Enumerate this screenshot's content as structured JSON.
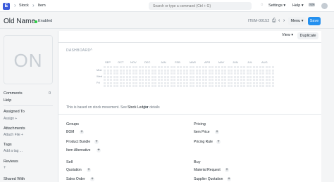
{
  "navbar": {
    "logo_letter": "E",
    "breadcrumbs": [
      "Stock",
      "Item"
    ],
    "search_placeholder": "Search or type a command (Ctrl + G)",
    "settings_label": "Settings",
    "help_label": "Help",
    "avatar_initial": "•"
  },
  "page": {
    "title": "Old Name",
    "status": "Enabled",
    "item_id": "ITEM-00152",
    "menu_label": "Menu",
    "save_label": "Save",
    "view_label": "View",
    "duplicate_label": "Duplicate"
  },
  "sidebar": {
    "image_placeholder": "ON",
    "comments_label": "Comments",
    "comments_count": "0",
    "help_label": "Help",
    "assigned_label": "Assigned To",
    "assign_label": "Assign",
    "attachments_label": "Attachments",
    "attach_label": "Attach File",
    "tags_label": "Tags",
    "add_tag_label": "Add a tag ...",
    "reviews_label": "Reviews",
    "shared_label": "Shared With"
  },
  "dashboard": {
    "title": "DASHBOARD",
    "months": [
      "SEP",
      "OCT",
      "NOV",
      "DEC",
      "JAN",
      "FEB",
      "MAR",
      "APR",
      "MAY",
      "JUN",
      "JUL",
      "AUG"
    ],
    "days": [
      "Mon",
      "Wed",
      "Fri"
    ],
    "note_prefix": "This is based on stock movement. See",
    "note_link": "Stock Ledger",
    "note_suffix": "for details"
  },
  "connections": {
    "groups": {
      "title": "Groups",
      "items": [
        "BOM",
        "Product Bundle",
        "Item Alternative"
      ]
    },
    "pricing": {
      "title": "Pricing",
      "items": [
        "Item Price",
        "Pricing Rule"
      ]
    },
    "sell": {
      "title": "Sell",
      "items": [
        "Quotation",
        "Sales Order"
      ]
    },
    "buy": {
      "title": "Buy",
      "items": [
        "Material Request",
        "Supplier Quotation"
      ]
    }
  },
  "colors": {
    "primary": "#2490ef",
    "status_enabled": "#29cd42",
    "heatmap_empty": "#ebedf0"
  }
}
